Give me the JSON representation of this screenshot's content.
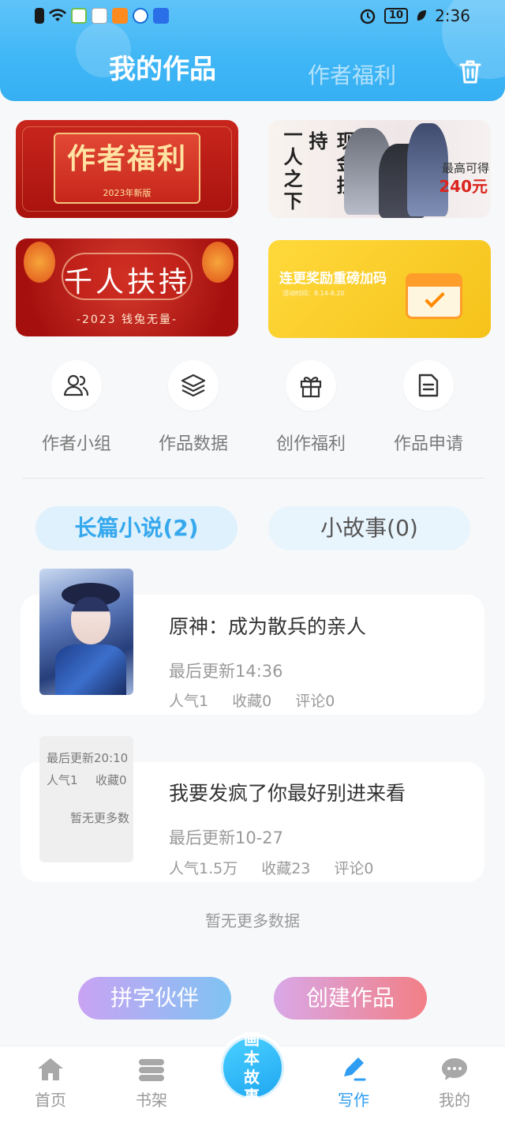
{
  "status_bar": {
    "time": "2:36",
    "battery": "10"
  },
  "header": {
    "active_tab": "我的作品",
    "inactive_tab": "作者福利"
  },
  "banners": {
    "b1": {
      "title": "作者福利",
      "subtitle": "2023年新版"
    },
    "b2": {
      "vertical1": "一人之下",
      "vertical2": "现金扶持",
      "label": "最高可得",
      "amount": "240元"
    },
    "b3": {
      "title": "千人扶持",
      "subtitle": "-2023 钱兔无量-"
    },
    "b4": {
      "title": "连更奖励重磅加码",
      "subtitle": "活动时间：8.14-8.20"
    }
  },
  "quick_menu": [
    {
      "label": "作者小组",
      "icon": "author-group-icon"
    },
    {
      "label": "作品数据",
      "icon": "layers-icon"
    },
    {
      "label": "创作福利",
      "icon": "gift-icon"
    },
    {
      "label": "作品申请",
      "icon": "document-icon"
    }
  ],
  "tabs": {
    "long": "长篇小说(2)",
    "short": "小故事(0)"
  },
  "works": [
    {
      "title": "原神：成为散兵的亲人",
      "updated": "最后更新14:36",
      "popularity": "人气1",
      "favorites": "收藏0",
      "comments": "评论0"
    },
    {
      "title": "我要发疯了你最好别进来看",
      "updated": "最后更新10-27",
      "popularity": "人气1.5万",
      "favorites": "收藏23",
      "comments": "评论0"
    }
  ],
  "cover2_overlay": {
    "updated": "最后更新20:10",
    "popularity": "人气1",
    "favorites": "收藏0",
    "nomore": "暂无更多数"
  },
  "list_footer": "暂无更多数据",
  "actions": {
    "partner": "拼字伙伴",
    "create": "创建作品"
  },
  "bottom_nav": {
    "home": "首页",
    "shelf": "书架",
    "center": "画本故事",
    "write": "写作",
    "mine": "我的"
  },
  "colors": {
    "header_blue": "#3fb6f6",
    "accent": "#2f9ef2",
    "tab_active_text": "#36a8ee"
  }
}
